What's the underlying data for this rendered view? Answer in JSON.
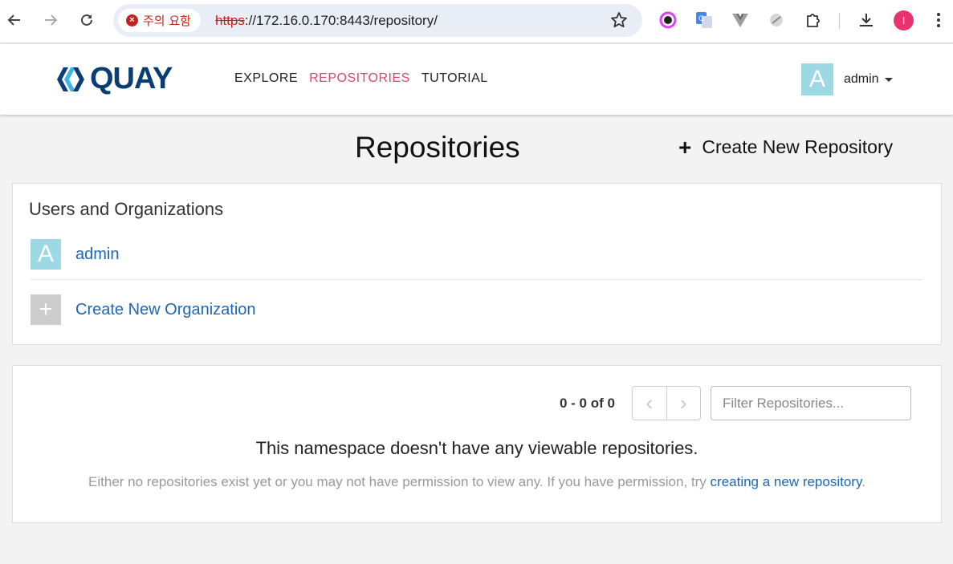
{
  "browser": {
    "security_label": "주의 요함",
    "url_scheme": "https",
    "url_rest": "://172.16.0.170:8443/repository/",
    "profile_initial": "I"
  },
  "header": {
    "logo_text": "QUAY",
    "nav": [
      {
        "label": "EXPLORE",
        "active": false
      },
      {
        "label": "REPOSITORIES",
        "active": true
      },
      {
        "label": "TUTORIAL",
        "active": false
      }
    ],
    "user": {
      "avatar_letter": "A",
      "name": "admin"
    }
  },
  "page": {
    "title": "Repositories",
    "create_repo_label": "Create New Repository"
  },
  "orgs_panel": {
    "heading": "Users and Organizations",
    "items": [
      {
        "avatar": "A",
        "label": "admin"
      },
      {
        "avatar": "+",
        "label": "Create New Organization"
      }
    ]
  },
  "repos_panel": {
    "pager_count": "0 - 0 of 0",
    "prev_symbol": "‹",
    "next_symbol": "›",
    "filter_placeholder": "Filter Repositories...",
    "empty_title": "This namespace doesn't have any viewable repositories.",
    "empty_desc_prefix": "Either no repositories exist yet or you may not have permission to view any. If you have permission, try ",
    "empty_desc_link": "creating a new repository",
    "empty_desc_suffix": "."
  },
  "colors": {
    "accent_nav": "#dd4668",
    "link": "#1f66b4",
    "logo": "#0a3d73",
    "avatar": "#9dd8e5",
    "insecure": "#c5221f"
  }
}
